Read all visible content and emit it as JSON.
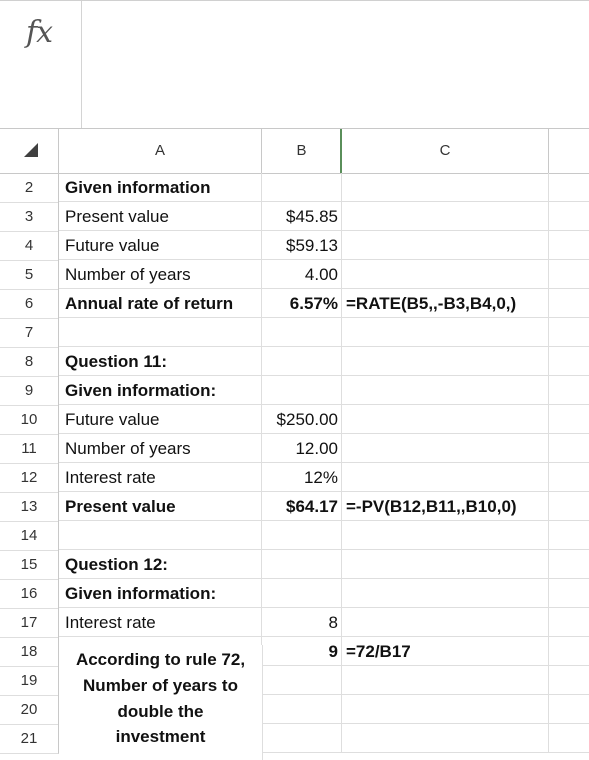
{
  "formula_bar": {
    "fx_label": "fx",
    "formula": ""
  },
  "columns": [
    "A",
    "B",
    "C"
  ],
  "rows": [
    {
      "num": "2",
      "a": "Given information",
      "b": "",
      "c": "",
      "a_bold": true,
      "b_bold": false,
      "c_bold": false
    },
    {
      "num": "3",
      "a": "Present value",
      "b": "$45.85",
      "c": "",
      "a_bold": false,
      "b_bold": false,
      "c_bold": false
    },
    {
      "num": "4",
      "a": "Future value",
      "b": "$59.13",
      "c": "",
      "a_bold": false,
      "b_bold": false,
      "c_bold": false
    },
    {
      "num": "5",
      "a": "Number of years",
      "b": "4.00",
      "c": "",
      "a_bold": false,
      "b_bold": false,
      "c_bold": false
    },
    {
      "num": "6",
      "a": "Annual rate of return",
      "b": "6.57%",
      "c": "=RATE(B5,,-B3,B4,0,)",
      "a_bold": true,
      "b_bold": true,
      "c_bold": true
    },
    {
      "num": "7",
      "a": "",
      "b": "",
      "c": "",
      "a_bold": false,
      "b_bold": false,
      "c_bold": false
    },
    {
      "num": "8",
      "a": "Question 11:",
      "b": "",
      "c": "",
      "a_bold": true,
      "b_bold": false,
      "c_bold": false
    },
    {
      "num": "9",
      "a": "Given information:",
      "b": "",
      "c": "",
      "a_bold": true,
      "b_bold": false,
      "c_bold": false
    },
    {
      "num": "10",
      "a": "Future value",
      "b": "$250.00",
      "c": "",
      "a_bold": false,
      "b_bold": false,
      "c_bold": false
    },
    {
      "num": "11",
      "a": "Number of years",
      "b": "12.00",
      "c": "",
      "a_bold": false,
      "b_bold": false,
      "c_bold": false
    },
    {
      "num": "12",
      "a": "Interest rate",
      "b": "12%",
      "c": "",
      "a_bold": false,
      "b_bold": false,
      "c_bold": false
    },
    {
      "num": "13",
      "a": "Present value",
      "b": "$64.17",
      "c": "=-PV(B12,B11,,B10,0)",
      "a_bold": true,
      "b_bold": true,
      "c_bold": true
    },
    {
      "num": "14",
      "a": "",
      "b": "",
      "c": "",
      "a_bold": false,
      "b_bold": false,
      "c_bold": false
    },
    {
      "num": "15",
      "a": "Question 12:",
      "b": "",
      "c": "",
      "a_bold": true,
      "b_bold": false,
      "c_bold": false
    },
    {
      "num": "16",
      "a": "Given information:",
      "b": "",
      "c": "",
      "a_bold": true,
      "b_bold": false,
      "c_bold": false
    },
    {
      "num": "17",
      "a": "Interest rate",
      "b": "8",
      "c": "",
      "a_bold": false,
      "b_bold": false,
      "c_bold": false
    },
    {
      "num": "18",
      "a": "",
      "b": "9",
      "c": "=72/B17",
      "a_bold": false,
      "b_bold": true,
      "c_bold": true
    },
    {
      "num": "19",
      "a": "",
      "b": "",
      "c": "",
      "a_bold": false,
      "b_bold": false,
      "c_bold": false
    },
    {
      "num": "20",
      "a": "",
      "b": "",
      "c": "",
      "a_bold": false,
      "b_bold": false,
      "c_bold": false
    },
    {
      "num": "21",
      "a": "",
      "b": "",
      "c": "",
      "a_bold": false,
      "b_bold": false,
      "c_bold": false
    }
  ],
  "merged_text": [
    "According to rule 72,",
    "Number of years to",
    "double the",
    "investment"
  ]
}
